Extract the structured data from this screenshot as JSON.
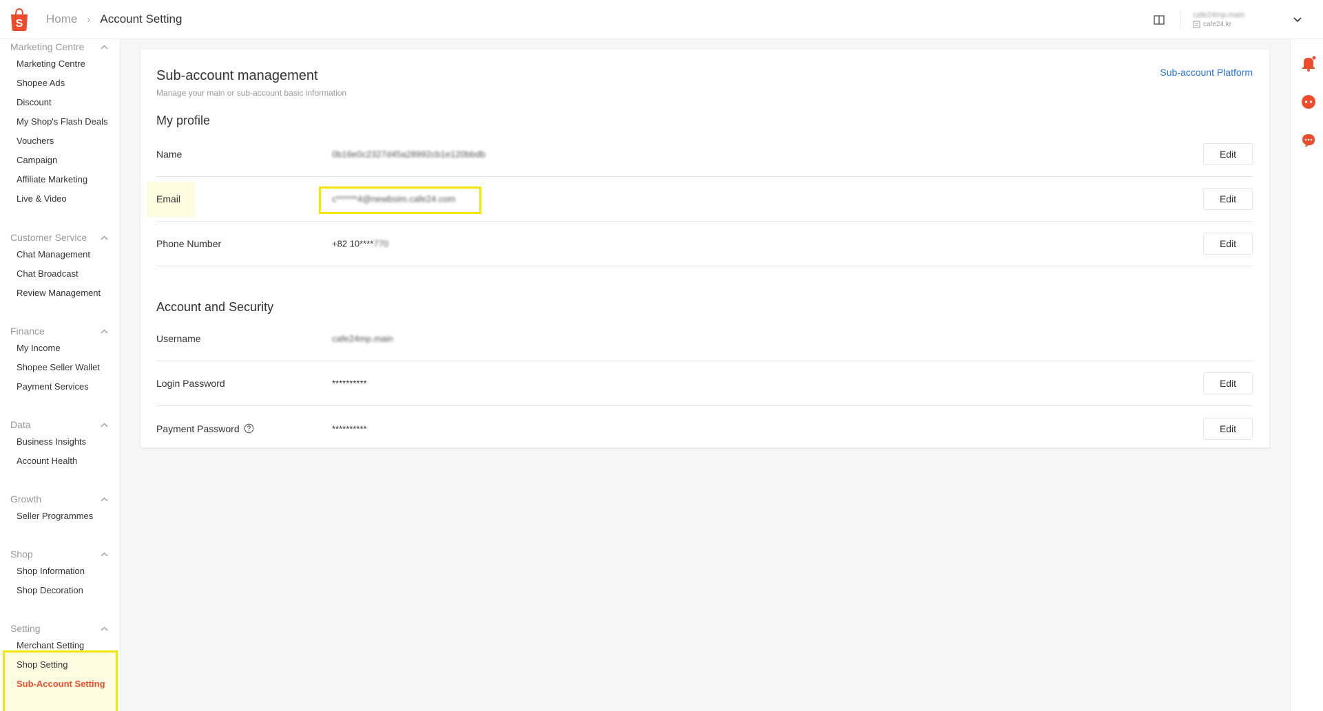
{
  "header": {
    "breadcrumb_home": "Home",
    "breadcrumb_current": "Account Setting",
    "account_name": "cafe24mp.main",
    "account_shop": "cafe24.kr"
  },
  "sidebar": {
    "groups": [
      {
        "title": "Marketing Centre",
        "items": [
          "Marketing Centre",
          "Shopee Ads",
          "Discount",
          "My Shop's Flash Deals",
          "Vouchers",
          "Campaign",
          "Affiliate Marketing",
          "Live & Video"
        ]
      },
      {
        "title": "Customer Service",
        "items": [
          "Chat Management",
          "Chat Broadcast",
          "Review Management"
        ]
      },
      {
        "title": "Finance",
        "items": [
          "My Income",
          "Shopee Seller Wallet",
          "Payment Services"
        ]
      },
      {
        "title": "Data",
        "items": [
          "Business Insights",
          "Account Health"
        ]
      },
      {
        "title": "Growth",
        "items": [
          "Seller Programmes"
        ]
      },
      {
        "title": "Shop",
        "items": [
          "Shop Information",
          "Shop Decoration"
        ]
      },
      {
        "title": "Setting",
        "items": [
          "Merchant Setting",
          "Shop Setting",
          "Sub-Account Setting"
        ]
      }
    ],
    "active_item": "Sub-Account Setting"
  },
  "main": {
    "title": "Sub-account management",
    "subtitle": "Manage your main or sub-account basic information",
    "platform_link": "Sub-account Platform",
    "edit_label": "Edit",
    "profile": {
      "title": "My profile",
      "rows": [
        {
          "label": "Name",
          "value": "0b16e0c2327d45a28992cb1e120bbdb"
        },
        {
          "label": "Email",
          "value": "c******4@newbsim.cafe24.com"
        },
        {
          "label": "Phone Number",
          "value_prefix": "+82 10****",
          "value_blurred": "770"
        }
      ]
    },
    "security": {
      "title": "Account and Security",
      "rows": [
        {
          "label": "Username",
          "value": "cafe24mp.main"
        },
        {
          "label": "Login Password",
          "value": "**********"
        },
        {
          "label": "Payment Password",
          "value": "**********"
        }
      ]
    }
  },
  "colors": {
    "brand": "#ee4d2d",
    "link": "#2673dd",
    "highlight": "#f5e600"
  },
  "icons": [
    "shopee-logo-icon",
    "chevron-right-icon",
    "book-icon",
    "shop-icon",
    "chevron-down-icon",
    "chevron-up-icon",
    "bell-icon",
    "headset-icon",
    "chat-icon",
    "question-icon"
  ]
}
